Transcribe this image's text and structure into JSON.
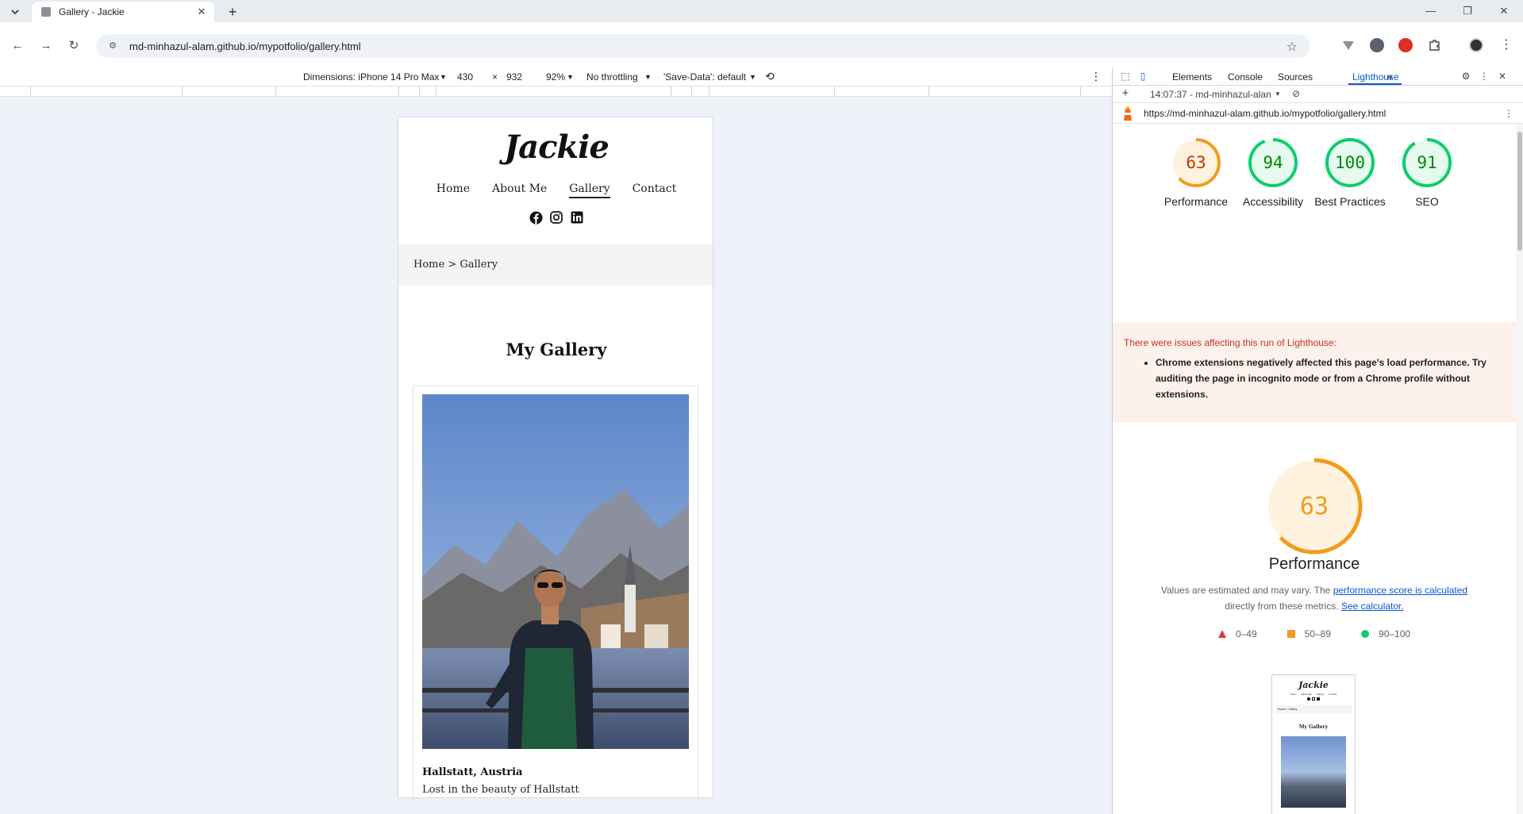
{
  "browser": {
    "tab_title": "Gallery - Jackie",
    "new_tab": "+",
    "url": "md-minhazul-alam.github.io/mypotfolio/gallery.html"
  },
  "device_toolbar": {
    "dimensions_label": "Dimensions: iPhone 14 Pro Max",
    "width": "430",
    "times": "×",
    "height": "932",
    "zoom": "92%",
    "throttling": "No throttling",
    "save_data": "'Save-Data': default"
  },
  "site": {
    "logo": "Jackie",
    "nav": [
      "Home",
      "About Me",
      "Gallery",
      "Contact"
    ],
    "breadcrumb": "Home > Gallery",
    "title": "My Gallery",
    "card_title": "Hallstatt, Austria",
    "card_caption": "Lost in the beauty of Hallstatt"
  },
  "devtools": {
    "tabs": [
      "Elements",
      "Console",
      "Sources",
      "Lighthouse"
    ],
    "more": "»",
    "report_time": "14:07:37 - md-minhazul-alan",
    "report_url": "https://md-minhazul-alam.github.io/mypotfolio/gallery.html"
  },
  "lighthouse": {
    "scores": [
      {
        "label": "Performance",
        "value": 63,
        "color": "#f29b1c"
      },
      {
        "label": "Accessibility",
        "value": 94,
        "color": "#0cce6b"
      },
      {
        "label": "Best Practices",
        "value": 100,
        "color": "#0cce6b"
      },
      {
        "label": "SEO",
        "value": 91,
        "color": "#0cce6b"
      }
    ],
    "warning_head": "There were issues affecting this run of Lighthouse:",
    "warning_item": "Chrome extensions negatively affected this page's load performance. Try auditing the page in incognito mode or from a Chrome profile without extensions.",
    "perf_title": "Performance",
    "perf_desc_1": "Values are estimated and may vary. The",
    "perf_link_1": "performance score is calculated",
    "perf_desc_2": "directly from these metrics.",
    "perf_link_2": "See calculator.",
    "legend": [
      "0–49",
      "50–89",
      "90–100"
    ],
    "legend_colors": [
      "#e8363b",
      "#f29b1c",
      "#0cce6b"
    ],
    "thumb_logo": "Jackie",
    "thumb_nav": [
      "Home",
      "About Me",
      "Gallery",
      "Contact"
    ],
    "thumb_breadcrumb": "Home > Gallery",
    "thumb_title": "My Gallery"
  }
}
